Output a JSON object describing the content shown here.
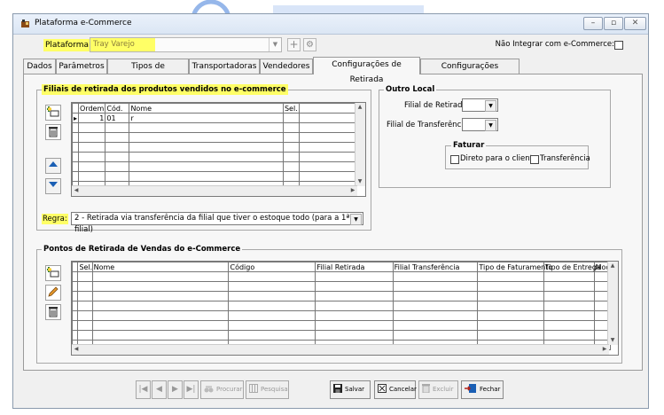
{
  "window": {
    "title": "Plataforma e-Commerce"
  },
  "header": {
    "plataforma_label": "Plataforma:",
    "plataforma_value": "Tray Varejo",
    "nao_integrar_label": "Não Integrar com e-Commerce:"
  },
  "tabs": [
    {
      "label": "Dados"
    },
    {
      "label": "Parâmetros"
    },
    {
      "label": "Tipos de Pagamento"
    },
    {
      "label": "Transportadoras"
    },
    {
      "label": "Vendedores"
    },
    {
      "label": "Configurações de Retirada",
      "active": true
    },
    {
      "label": "Configurações Adicionais"
    }
  ],
  "filiais": {
    "title": "Filiais de retirada dos produtos vendidos no e-commerce",
    "columns": [
      "Ordem",
      "Cód.",
      "Nome",
      "Sel."
    ],
    "rows": [
      {
        "ordem": "1",
        "cod": "01",
        "nome": "r",
        "sel": ""
      }
    ],
    "regra_label": "Regra:",
    "regra_value": "2 - Retirada via transferência da filial que tiver o estoque todo (para a 1ª filial)"
  },
  "outro_local": {
    "title": "Outro Local",
    "filial_retirada_label": "Filial de Retirada:",
    "filial_transferencia_label": "Filial de Transferência:",
    "faturar_title": "Faturar",
    "direto_label": "Direto para o cliente",
    "transferencia_label": "Transferência"
  },
  "pontos": {
    "title": "Pontos de Retirada de Vendas do e-Commerce",
    "columns": [
      "Sel.",
      "Nome",
      "Código",
      "Filial Retirada",
      "Filial Transferência",
      "Tipo de Faturamento",
      "Tipo de Entrega",
      "Moda"
    ]
  },
  "bottom": {
    "procurar": "Procurar",
    "pesquisa": "Pesquisa",
    "salvar": "Salvar",
    "cancelar": "Cancelar",
    "excluir": "Excluir",
    "fechar": "Fechar"
  },
  "colors": {
    "highlight": "#ffff66",
    "accent_blue": "#1a5fb4"
  }
}
